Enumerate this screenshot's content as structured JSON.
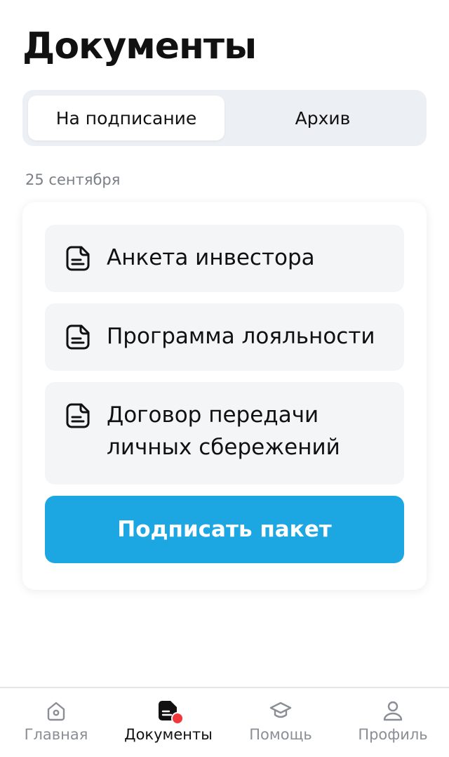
{
  "page": {
    "title": "Документы"
  },
  "tabs": [
    {
      "label": "На подписание",
      "active": true
    },
    {
      "label": "Архив",
      "active": false
    }
  ],
  "group": {
    "date": "25 сентября",
    "documents": [
      {
        "title": "Анкета инвестора",
        "icon": "document-icon"
      },
      {
        "title": "Программа лояльности",
        "icon": "document-icon"
      },
      {
        "title": "Договор передачи личных сбережений",
        "icon": "document-icon"
      }
    ],
    "sign_button_label": "Подписать пакет"
  },
  "bottom_nav": {
    "items": [
      {
        "label": "Главная",
        "icon": "home-icon",
        "active": false
      },
      {
        "label": "Документы",
        "icon": "documents-icon",
        "active": true,
        "badge": true
      },
      {
        "label": "Помощь",
        "icon": "graduation-cap-icon",
        "active": false
      },
      {
        "label": "Профиль",
        "icon": "profile-icon",
        "active": false
      }
    ]
  },
  "colors": {
    "accent": "#1da7e2",
    "badge": "#f0373c",
    "segment_bg": "#eceff3",
    "item_bg": "#f4f5f7"
  }
}
